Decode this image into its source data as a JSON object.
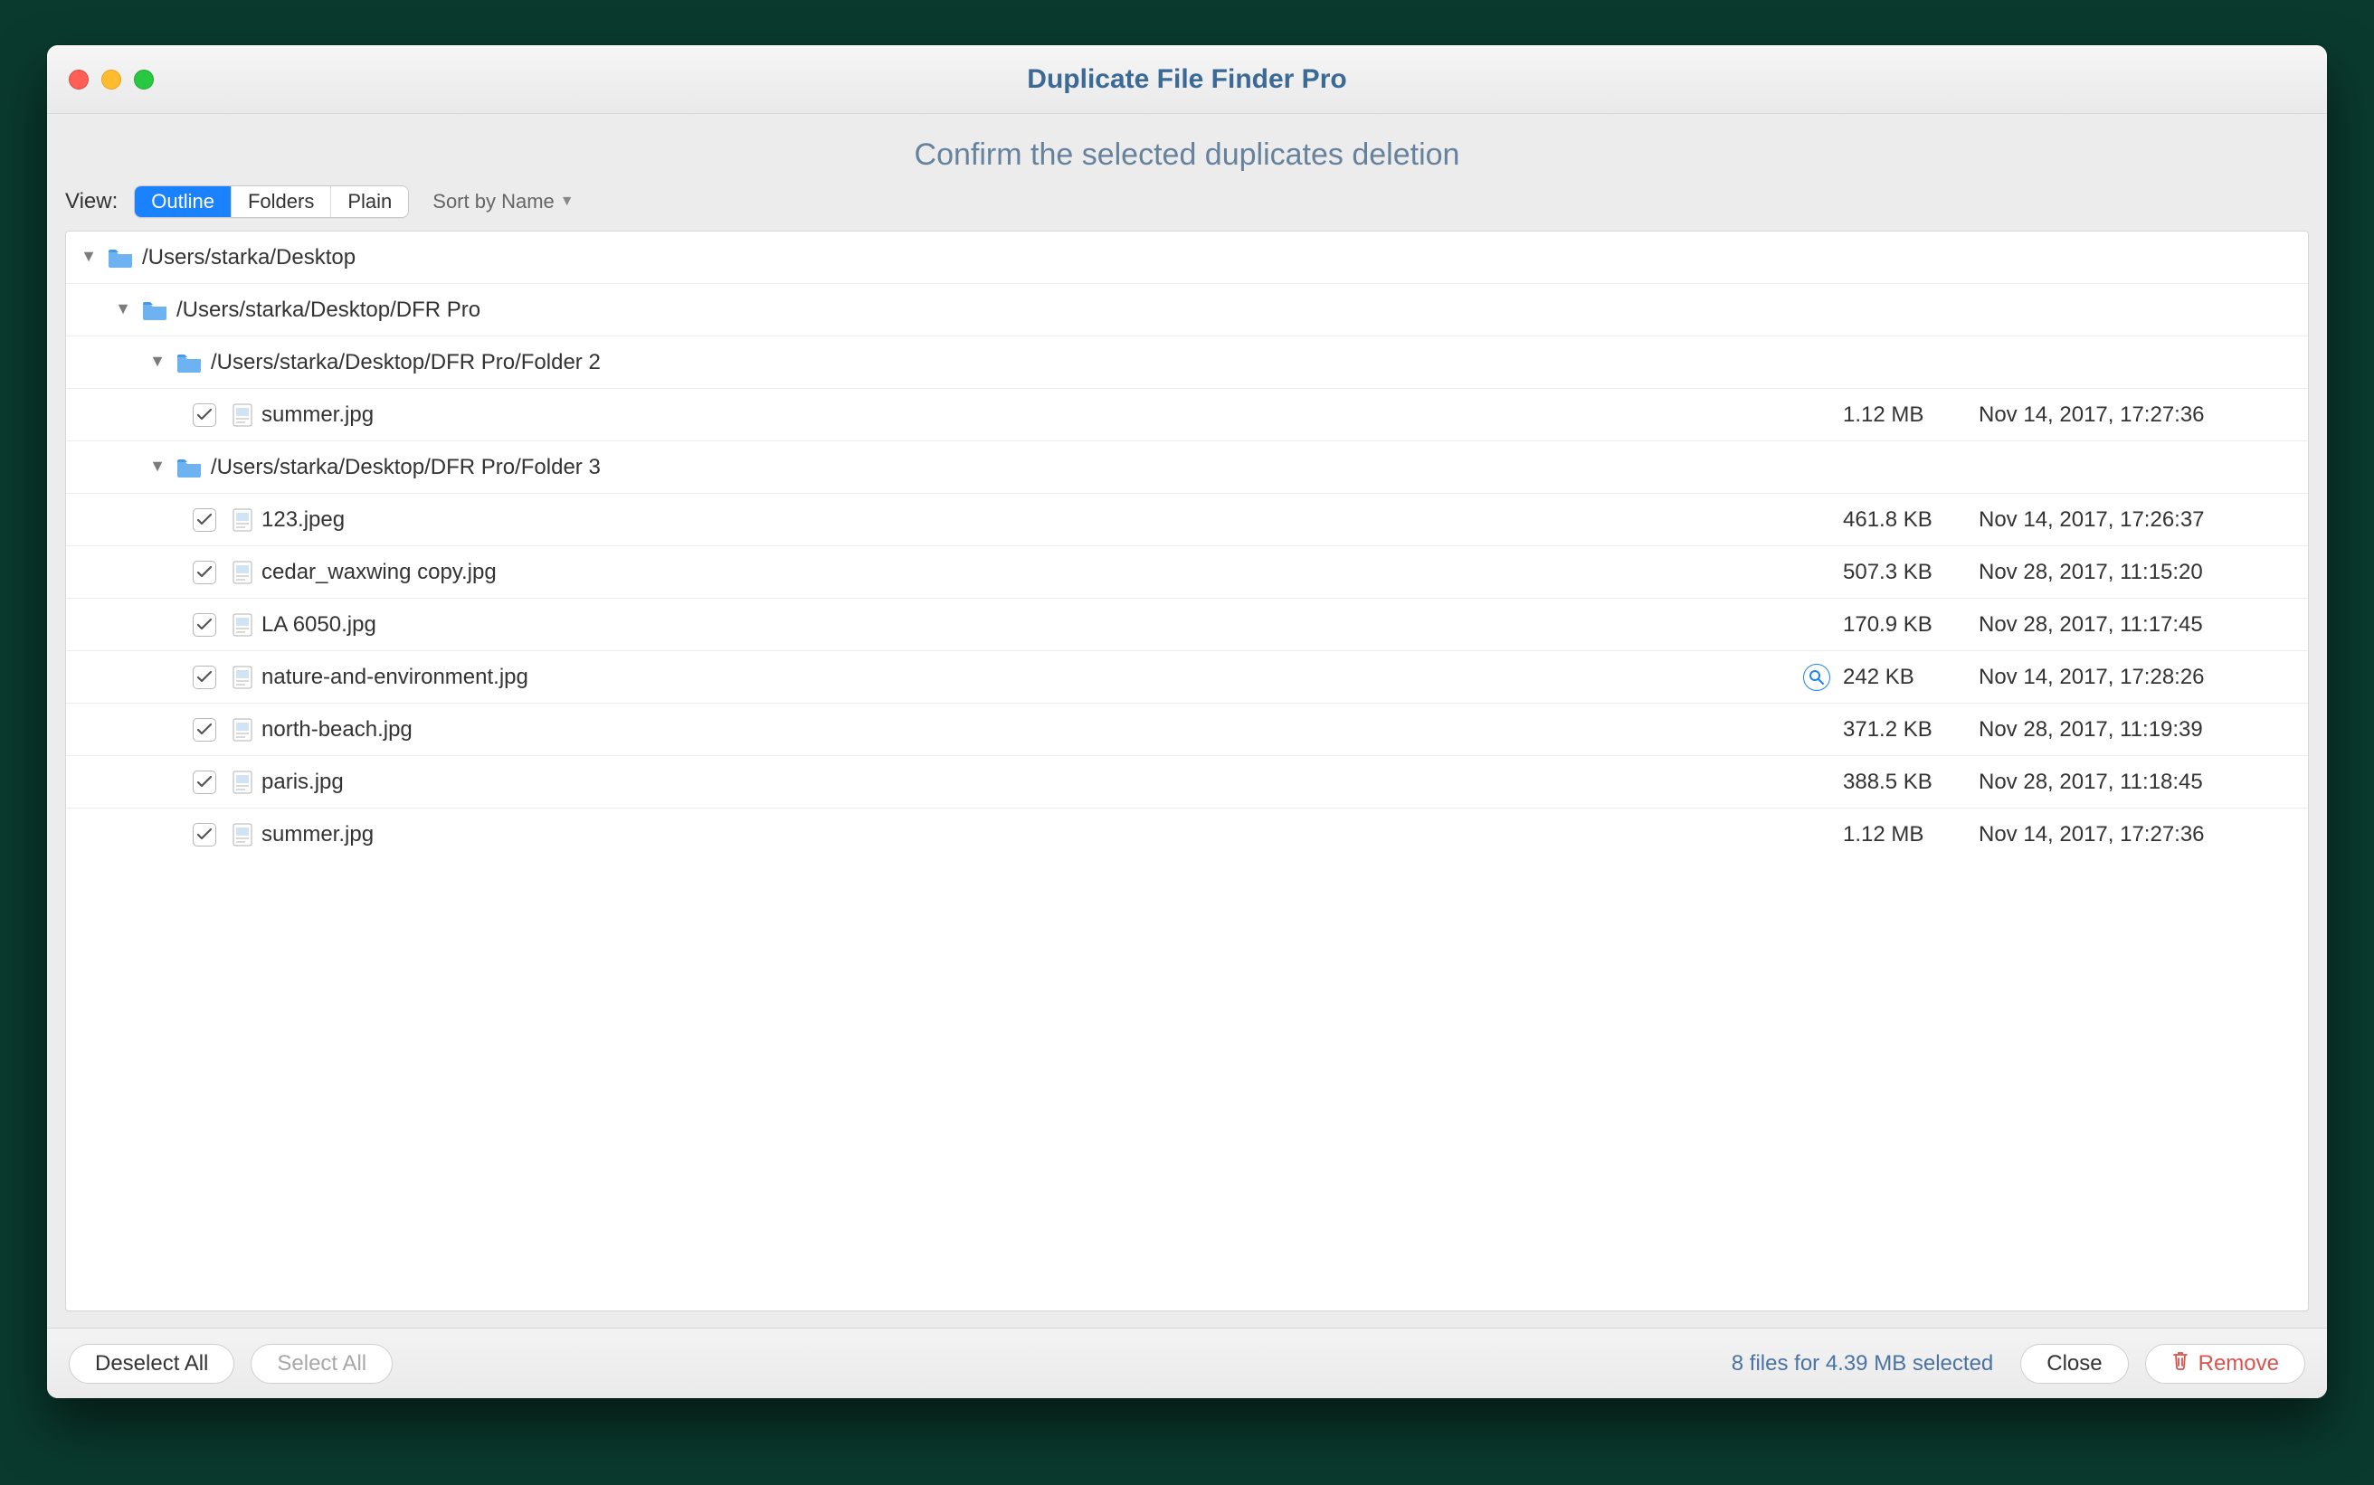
{
  "window": {
    "title": "Duplicate File Finder Pro"
  },
  "header": {
    "subtitle": "Confirm the selected duplicates deletion"
  },
  "toolbar": {
    "view_label": "View:",
    "segments": {
      "outline": "Outline",
      "folders": "Folders",
      "plain": "Plain"
    },
    "sort_label": "Sort by Name"
  },
  "tree": {
    "root": {
      "path": "/Users/starka/Desktop",
      "children": [
        {
          "path": "/Users/starka/Desktop/DFR Pro",
          "children": [
            {
              "path": "/Users/starka/Desktop/DFR Pro/Folder 2",
              "files": [
                {
                  "name": "summer.jpg",
                  "size": "1.12 MB",
                  "date": "Nov 14, 2017, 17:27:36",
                  "checked": true
                }
              ]
            },
            {
              "path": "/Users/starka/Desktop/DFR Pro/Folder 3",
              "files": [
                {
                  "name": "123.jpeg",
                  "size": "461.8 KB",
                  "date": "Nov 14, 2017, 17:26:37",
                  "checked": true
                },
                {
                  "name": "cedar_waxwing copy.jpg",
                  "size": "507.3 KB",
                  "date": "Nov 28, 2017, 11:15:20",
                  "checked": true
                },
                {
                  "name": "LA 6050.jpg",
                  "size": "170.9 KB",
                  "date": "Nov 28, 2017, 11:17:45",
                  "checked": true
                },
                {
                  "name": "nature-and-environment.jpg",
                  "size": "242 KB",
                  "date": "Nov 14, 2017, 17:28:26",
                  "checked": true,
                  "preview": true
                },
                {
                  "name": "north-beach.jpg",
                  "size": "371.2 KB",
                  "date": "Nov 28, 2017, 11:19:39",
                  "checked": true
                },
                {
                  "name": "paris.jpg",
                  "size": "388.5 KB",
                  "date": "Nov 28, 2017, 11:18:45",
                  "checked": true
                },
                {
                  "name": "summer.jpg",
                  "size": "1.12 MB",
                  "date": "Nov 14, 2017, 17:27:36",
                  "checked": true
                }
              ]
            }
          ]
        }
      ]
    }
  },
  "footer": {
    "deselect_label": "Deselect All",
    "select_label": "Select All",
    "status": "8 files for 4.39 MB selected",
    "close_label": "Close",
    "remove_label": "Remove"
  }
}
